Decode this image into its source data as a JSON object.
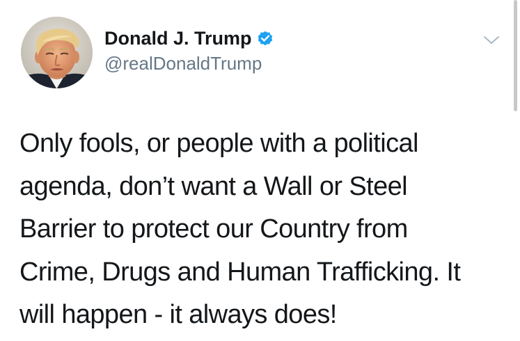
{
  "tweet": {
    "author": {
      "display_name": "Donald J. Trump",
      "handle": "@realDonaldTrump",
      "verified": true,
      "verified_icon": "verified-badge-icon",
      "avatar_icon": "profile-avatar"
    },
    "menu_icon": "chevron-down-icon",
    "text": "Only fools, or people with a political\nagenda, don’t want a Wall or Steel\nBarrier to protect our Country from\nCrime, Drugs and Human Trafficking. It\nwill happen - it always does!"
  },
  "colors": {
    "text": "#14171a",
    "secondary_text": "#657786",
    "verified_blue": "#1da1f2",
    "caret": "#aab8c2"
  }
}
